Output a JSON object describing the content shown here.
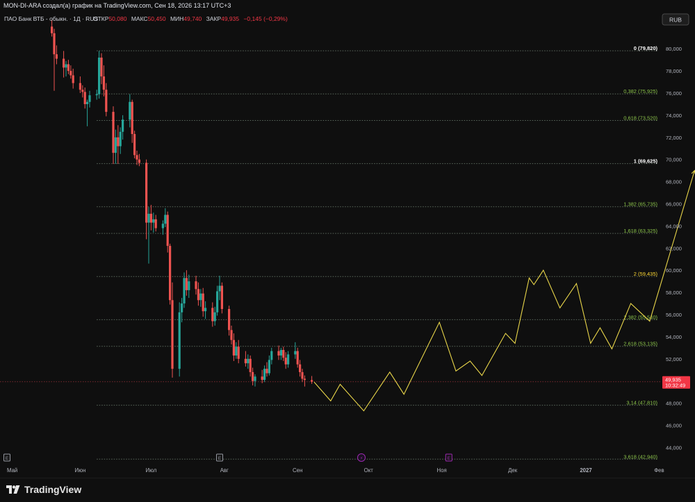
{
  "header": {
    "credit": "MON-DI-ARA создал(а) график на TradingView.com, Сен 18, 2026 13:17 UTC+3"
  },
  "legend": {
    "symbol": "ПАО Банк ВТБ - обыкн. · 1Д · RUS",
    "open_label": "ОТКР",
    "open": "50,080",
    "high_label": "МАКС",
    "high": "50,450",
    "low_label": "МИН",
    "low": "49,740",
    "close_label": "ЗАКР",
    "close": "49,935",
    "change": "−0,145 (−0,29%)"
  },
  "currency_button": "RUB",
  "footer": {
    "brand": "TradingView"
  },
  "colors": {
    "background": "#0f0f0f",
    "up": "#26a69a",
    "down": "#ef5350",
    "forecast": "#e8d54a",
    "fib_white": "#ffffff",
    "fib_green": "#8bc34a",
    "fib_yellow": "#fdd835",
    "fib_line": "#5d6b5f",
    "price_tag": "#f23645"
  },
  "chart_data": {
    "type": "candlestick",
    "y_axis": {
      "min": 43.8,
      "max": 82.6,
      "ticks": [
        44,
        46,
        48,
        52,
        54,
        56,
        58,
        60,
        62,
        64,
        66,
        68,
        70,
        72,
        74,
        76,
        78,
        80
      ],
      "tick_labels": [
        "44,000",
        "46,000",
        "48,000",
        "52,000",
        "54,000",
        "56,000",
        "58,000",
        "60,000",
        "62,000",
        "64,000",
        "66,000",
        "68,000",
        "70,000",
        "72,000",
        "74,000",
        "76,000",
        "78,000",
        "80,000"
      ]
    },
    "x_axis": {
      "labels": [
        {
          "date": "2026-05-01",
          "text": "Май"
        },
        {
          "date": "2026-06-01",
          "text": "Июн"
        },
        {
          "date": "2026-07-01",
          "text": "Июл"
        },
        {
          "date": "2026-08-01",
          "text": "Авг"
        },
        {
          "date": "2026-09-01",
          "text": "Сен"
        },
        {
          "date": "2026-10-01",
          "text": "Окт"
        },
        {
          "date": "2026-11-01",
          "text": "Ноя"
        },
        {
          "date": "2026-12-01",
          "text": "Дек"
        },
        {
          "date": "2027-01-01",
          "text": "2027"
        },
        {
          "date": "2027-02-01",
          "text": "Фев"
        }
      ]
    },
    "fibonacci_levels": [
      {
        "ratio": "0",
        "value": 79.82,
        "label": "0 (79,820)",
        "color": "white"
      },
      {
        "ratio": "0,382",
        "value": 75.925,
        "label": "0,382 (75,925)",
        "color": "green"
      },
      {
        "ratio": "0,618",
        "value": 73.52,
        "label": "0,618 (73,520)",
        "color": "green"
      },
      {
        "ratio": "1",
        "value": 69.625,
        "label": "1 (69,625)",
        "color": "white"
      },
      {
        "ratio": "1,382",
        "value": 65.735,
        "label": "1,382 (65,735)",
        "color": "green"
      },
      {
        "ratio": "1,618",
        "value": 63.325,
        "label": "1,618 (63,325)",
        "color": "green"
      },
      {
        "ratio": "2",
        "value": 59.435,
        "label": "2 (59,435)",
        "color": "yellow"
      },
      {
        "ratio": "2,382",
        "value": 55.54,
        "label": "2,382 (55,540)",
        "color": "green"
      },
      {
        "ratio": "2,618",
        "value": 53.135,
        "label": "2,618 (53,135)",
        "color": "green"
      },
      {
        "ratio": "3,14",
        "value": 47.81,
        "label": "3,14 (47,810)",
        "color": "green"
      },
      {
        "ratio": "3,618",
        "value": 42.94,
        "label": "3,618 (42,940)",
        "color": "green"
      }
    ],
    "fib_start_date": "2026-06-08",
    "last_price": {
      "value": 49.935,
      "label": "49,935",
      "countdown": "10:32:49"
    },
    "candles": [
      {
        "t": "2026-05-20",
        "o": 82.0,
        "h": 82.6,
        "l": 81.1,
        "c": 81.4
      },
      {
        "t": "2026-05-21",
        "o": 81.4,
        "h": 81.8,
        "l": 76.2,
        "c": 79.5
      },
      {
        "t": "2026-05-22",
        "o": 79.5,
        "h": 80.3,
        "l": 78.6,
        "c": 79.1
      },
      {
        "t": "2026-05-25",
        "o": 79.1,
        "h": 79.8,
        "l": 77.4,
        "c": 78.3
      },
      {
        "t": "2026-05-26",
        "o": 78.3,
        "h": 78.9,
        "l": 77.5,
        "c": 78.6
      },
      {
        "t": "2026-05-27",
        "o": 78.6,
        "h": 79.0,
        "l": 77.7,
        "c": 78.0
      },
      {
        "t": "2026-05-28",
        "o": 78.0,
        "h": 78.5,
        "l": 77.3,
        "c": 77.6
      },
      {
        "t": "2026-05-29",
        "o": 77.6,
        "h": 78.2,
        "l": 76.4,
        "c": 76.9
      },
      {
        "t": "2026-06-01",
        "o": 76.9,
        "h": 77.5,
        "l": 76.0,
        "c": 76.3
      },
      {
        "t": "2026-06-02",
        "o": 76.3,
        "h": 76.7,
        "l": 75.6,
        "c": 76.1
      },
      {
        "t": "2026-06-03",
        "o": 76.1,
        "h": 76.5,
        "l": 74.6,
        "c": 75.0
      },
      {
        "t": "2026-06-04",
        "o": 75.0,
        "h": 75.4,
        "l": 73.0,
        "c": 75.2
      },
      {
        "t": "2026-06-05",
        "o": 75.2,
        "h": 76.2,
        "l": 74.7,
        "c": 75.8
      },
      {
        "t": "2026-06-08",
        "o": 75.8,
        "h": 76.3,
        "l": 75.4,
        "c": 75.9
      },
      {
        "t": "2026-06-09",
        "o": 75.9,
        "h": 79.8,
        "l": 75.5,
        "c": 79.2
      },
      {
        "t": "2026-06-10",
        "o": 79.2,
        "h": 79.6,
        "l": 76.8,
        "c": 77.5
      },
      {
        "t": "2026-06-11",
        "o": 77.5,
        "h": 78.5,
        "l": 75.7,
        "c": 76.3
      },
      {
        "t": "2026-06-12",
        "o": 76.3,
        "h": 76.9,
        "l": 73.9,
        "c": 74.3
      },
      {
        "t": "2026-06-15",
        "o": 74.3,
        "h": 74.8,
        "l": 69.6,
        "c": 70.6
      },
      {
        "t": "2026-06-16",
        "o": 70.6,
        "h": 72.7,
        "l": 69.6,
        "c": 72.0
      },
      {
        "t": "2026-06-17",
        "o": 72.0,
        "h": 73.1,
        "l": 69.6,
        "c": 71.2
      },
      {
        "t": "2026-06-18",
        "o": 71.2,
        "h": 72.9,
        "l": 70.5,
        "c": 72.5
      },
      {
        "t": "2026-06-19",
        "o": 72.5,
        "h": 74.0,
        "l": 71.8,
        "c": 73.6
      },
      {
        "t": "2026-06-22",
        "o": 73.6,
        "h": 75.9,
        "l": 72.9,
        "c": 75.2
      },
      {
        "t": "2026-06-23",
        "o": 75.2,
        "h": 75.4,
        "l": 71.5,
        "c": 72.3
      },
      {
        "t": "2026-06-24",
        "o": 72.3,
        "h": 72.6,
        "l": 70.1,
        "c": 70.4
      },
      {
        "t": "2026-06-25",
        "o": 70.4,
        "h": 70.8,
        "l": 69.5,
        "c": 70.0
      },
      {
        "t": "2026-06-26",
        "o": 70.0,
        "h": 70.5,
        "l": 69.4,
        "c": 69.7
      },
      {
        "t": "2026-06-29",
        "o": 69.7,
        "h": 70.0,
        "l": 62.8,
        "c": 64.3
      },
      {
        "t": "2026-06-30",
        "o": 64.3,
        "h": 65.7,
        "l": 60.6,
        "c": 65.1
      },
      {
        "t": "2026-07-01",
        "o": 65.1,
        "h": 65.9,
        "l": 63.6,
        "c": 64.3
      },
      {
        "t": "2026-07-02",
        "o": 64.3,
        "h": 65.2,
        "l": 63.4,
        "c": 64.6
      },
      {
        "t": "2026-07-03",
        "o": 64.6,
        "h": 65.0,
        "l": 63.5,
        "c": 63.8
      },
      {
        "t": "2026-07-06",
        "o": 63.8,
        "h": 64.5,
        "l": 63.2,
        "c": 64.2
      },
      {
        "t": "2026-07-07",
        "o": 64.2,
        "h": 65.6,
        "l": 63.9,
        "c": 65.0
      },
      {
        "t": "2026-07-08",
        "o": 65.0,
        "h": 65.3,
        "l": 61.6,
        "c": 62.2
      },
      {
        "t": "2026-07-09",
        "o": 62.2,
        "h": 62.4,
        "l": 56.9,
        "c": 57.3
      },
      {
        "t": "2026-07-10",
        "o": 57.3,
        "h": 58.9,
        "l": 50.3,
        "c": 51.1
      },
      {
        "t": "2026-07-13",
        "o": 51.1,
        "h": 57.1,
        "l": 50.4,
        "c": 56.2
      },
      {
        "t": "2026-07-14",
        "o": 56.2,
        "h": 57.5,
        "l": 55.3,
        "c": 57.0
      },
      {
        "t": "2026-07-15",
        "o": 57.0,
        "h": 59.8,
        "l": 56.6,
        "c": 59.3
      },
      {
        "t": "2026-07-16",
        "o": 59.3,
        "h": 60.0,
        "l": 57.7,
        "c": 58.2
      },
      {
        "t": "2026-07-17",
        "o": 58.2,
        "h": 59.6,
        "l": 57.5,
        "c": 59.0
      },
      {
        "t": "2026-07-20",
        "o": 59.0,
        "h": 59.5,
        "l": 57.8,
        "c": 58.3
      },
      {
        "t": "2026-07-21",
        "o": 58.3,
        "h": 58.9,
        "l": 56.8,
        "c": 57.3
      },
      {
        "t": "2026-07-22",
        "o": 57.3,
        "h": 58.3,
        "l": 56.7,
        "c": 57.9
      },
      {
        "t": "2026-07-23",
        "o": 57.9,
        "h": 58.4,
        "l": 55.8,
        "c": 56.3
      },
      {
        "t": "2026-07-24",
        "o": 56.3,
        "h": 57.2,
        "l": 55.6,
        "c": 56.6
      },
      {
        "t": "2026-07-27",
        "o": 56.6,
        "h": 57.1,
        "l": 54.9,
        "c": 55.4
      },
      {
        "t": "2026-07-28",
        "o": 55.4,
        "h": 56.7,
        "l": 55.0,
        "c": 56.2
      },
      {
        "t": "2026-07-29",
        "o": 56.2,
        "h": 58.6,
        "l": 55.9,
        "c": 58.1
      },
      {
        "t": "2026-07-30",
        "o": 58.1,
        "h": 59.5,
        "l": 57.3,
        "c": 58.6
      },
      {
        "t": "2026-07-31",
        "o": 58.6,
        "h": 58.9,
        "l": 56.1,
        "c": 56.5
      },
      {
        "t": "2026-08-03",
        "o": 56.5,
        "h": 56.8,
        "l": 54.1,
        "c": 54.6
      },
      {
        "t": "2026-08-04",
        "o": 54.6,
        "h": 55.0,
        "l": 53.3,
        "c": 53.7
      },
      {
        "t": "2026-08-05",
        "o": 53.7,
        "h": 54.3,
        "l": 51.8,
        "c": 52.3
      },
      {
        "t": "2026-08-06",
        "o": 52.3,
        "h": 53.5,
        "l": 52.0,
        "c": 53.1
      },
      {
        "t": "2026-08-07",
        "o": 53.1,
        "h": 53.7,
        "l": 51.6,
        "c": 52.0
      },
      {
        "t": "2026-08-10",
        "o": 52.0,
        "h": 52.7,
        "l": 51.3,
        "c": 51.6
      },
      {
        "t": "2026-08-11",
        "o": 51.6,
        "h": 52.4,
        "l": 51.1,
        "c": 52.0
      },
      {
        "t": "2026-08-12",
        "o": 52.0,
        "h": 52.3,
        "l": 50.4,
        "c": 50.8
      },
      {
        "t": "2026-08-13",
        "o": 50.8,
        "h": 51.2,
        "l": 49.6,
        "c": 50.0
      },
      {
        "t": "2026-08-14",
        "o": 50.0,
        "h": 50.6,
        "l": 49.5,
        "c": 50.4
      },
      {
        "t": "2026-08-17",
        "o": 50.4,
        "h": 51.0,
        "l": 49.8,
        "c": 50.1
      },
      {
        "t": "2026-08-18",
        "o": 50.1,
        "h": 51.4,
        "l": 49.9,
        "c": 51.1
      },
      {
        "t": "2026-08-19",
        "o": 51.1,
        "h": 51.7,
        "l": 50.4,
        "c": 50.7
      },
      {
        "t": "2026-08-20",
        "o": 50.7,
        "h": 52.3,
        "l": 50.5,
        "c": 51.9
      },
      {
        "t": "2026-08-21",
        "o": 51.9,
        "h": 53.0,
        "l": 51.5,
        "c": 52.7
      },
      {
        "t": "2026-08-24",
        "o": 52.7,
        "h": 53.2,
        "l": 51.9,
        "c": 52.3
      },
      {
        "t": "2026-08-25",
        "o": 52.3,
        "h": 53.0,
        "l": 51.9,
        "c": 52.8
      },
      {
        "t": "2026-08-26",
        "o": 52.8,
        "h": 53.1,
        "l": 51.8,
        "c": 52.1
      },
      {
        "t": "2026-08-27",
        "o": 52.1,
        "h": 52.6,
        "l": 51.1,
        "c": 51.5
      },
      {
        "t": "2026-08-28",
        "o": 51.5,
        "h": 52.7,
        "l": 51.2,
        "c": 52.4
      },
      {
        "t": "2026-08-31",
        "o": 52.4,
        "h": 53.5,
        "l": 52.0,
        "c": 52.7
      },
      {
        "t": "2026-09-01",
        "o": 52.7,
        "h": 53.0,
        "l": 51.2,
        "c": 51.5
      },
      {
        "t": "2026-09-02",
        "o": 51.5,
        "h": 51.9,
        "l": 50.4,
        "c": 50.8
      },
      {
        "t": "2026-09-03",
        "o": 50.8,
        "h": 51.1,
        "l": 49.9,
        "c": 50.2
      },
      {
        "t": "2026-09-04",
        "o": 50.2,
        "h": 50.5,
        "l": 49.5,
        "c": 50.1
      },
      {
        "t": "2026-09-07",
        "o": 50.08,
        "h": 50.45,
        "l": 49.74,
        "c": 49.935
      }
    ],
    "forecast_path": [
      {
        "t": "2026-09-08",
        "y": 49.9
      },
      {
        "t": "2026-09-15",
        "y": 48.2
      },
      {
        "t": "2026-09-19",
        "y": 49.7
      },
      {
        "t": "2026-09-29",
        "y": 47.3
      },
      {
        "t": "2026-10-10",
        "y": 50.8
      },
      {
        "t": "2026-10-16",
        "y": 48.8
      },
      {
        "t": "2026-10-31",
        "y": 55.3
      },
      {
        "t": "2026-11-07",
        "y": 50.9
      },
      {
        "t": "2026-11-13",
        "y": 51.8
      },
      {
        "t": "2026-11-18",
        "y": 50.5
      },
      {
        "t": "2026-11-28",
        "y": 54.3
      },
      {
        "t": "2026-12-02",
        "y": 53.4
      },
      {
        "t": "2026-12-08",
        "y": 59.3
      },
      {
        "t": "2026-12-10",
        "y": 58.7
      },
      {
        "t": "2026-12-14",
        "y": 60.0
      },
      {
        "t": "2026-12-21",
        "y": 56.6
      },
      {
        "t": "2026-12-28",
        "y": 58.8
      },
      {
        "t": "2027-01-03",
        "y": 53.4
      },
      {
        "t": "2027-01-07",
        "y": 54.8
      },
      {
        "t": "2027-01-12",
        "y": 52.9
      },
      {
        "t": "2027-01-20",
        "y": 57.0
      },
      {
        "t": "2027-01-28",
        "y": 55.4
      },
      {
        "t": "2027-02-16",
        "y": 69.0
      }
    ],
    "event_markers": [
      {
        "date": "2026-05-01",
        "glyph": "E",
        "kind": "earnings",
        "color": "#9598a1"
      },
      {
        "date": "2026-07-30",
        "glyph": "E",
        "kind": "earnings",
        "color": "#9598a1"
      },
      {
        "date": "2026-09-28",
        "glyph": "⚡",
        "kind": "dividend",
        "color": "#9c27b0"
      },
      {
        "date": "2026-11-04",
        "glyph": "E",
        "kind": "earnings",
        "color": "#9c27b0"
      }
    ]
  }
}
